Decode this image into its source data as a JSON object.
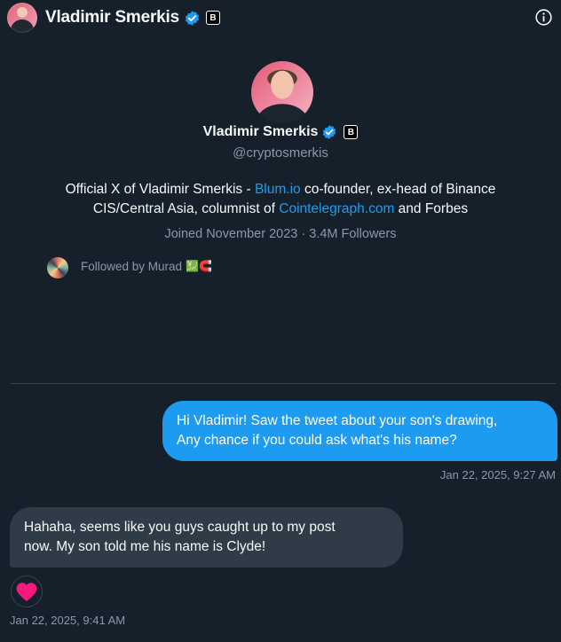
{
  "header": {
    "name": "Vladimir Smerkis",
    "badge_letter": "B"
  },
  "profile": {
    "name": "Vladimir Smerkis",
    "badge_letter": "B",
    "handle": "@cryptosmerkis",
    "bio": {
      "part1": "Official X of Vladimir Smerkis - ",
      "link1": "Blum.io",
      "part2": " co-founder, ex-head of Binance",
      "part3": "CIS/Central Asia, columnist of ",
      "link2": "Cointelegraph.com",
      "part4": " and Forbes"
    },
    "joined": "Joined November 2023 · 3.4M Followers",
    "followed_by": "Followed by Murad",
    "followed_emoji": "💹🧲"
  },
  "messages": [
    {
      "direction": "outgoing",
      "line1": "Hi Vladimir! Saw the tweet about your son's drawing,",
      "line2": "Any chance if you could ask what's his name?",
      "time": "Jan 22, 2025, 9:27 AM"
    },
    {
      "direction": "incoming",
      "line1": "Hahaha, seems like you guys caught up to my post",
      "line2": "now. My son told me his name is Clyde!",
      "time": "Jan 22, 2025, 9:41 AM",
      "reaction": "heart-icon"
    }
  ],
  "colors": {
    "background": "#15202b",
    "accent": "#1d9bf0",
    "incoming_bubble": "#2f3c47",
    "muted_text": "#8b98a5",
    "heart": "#f91880"
  }
}
